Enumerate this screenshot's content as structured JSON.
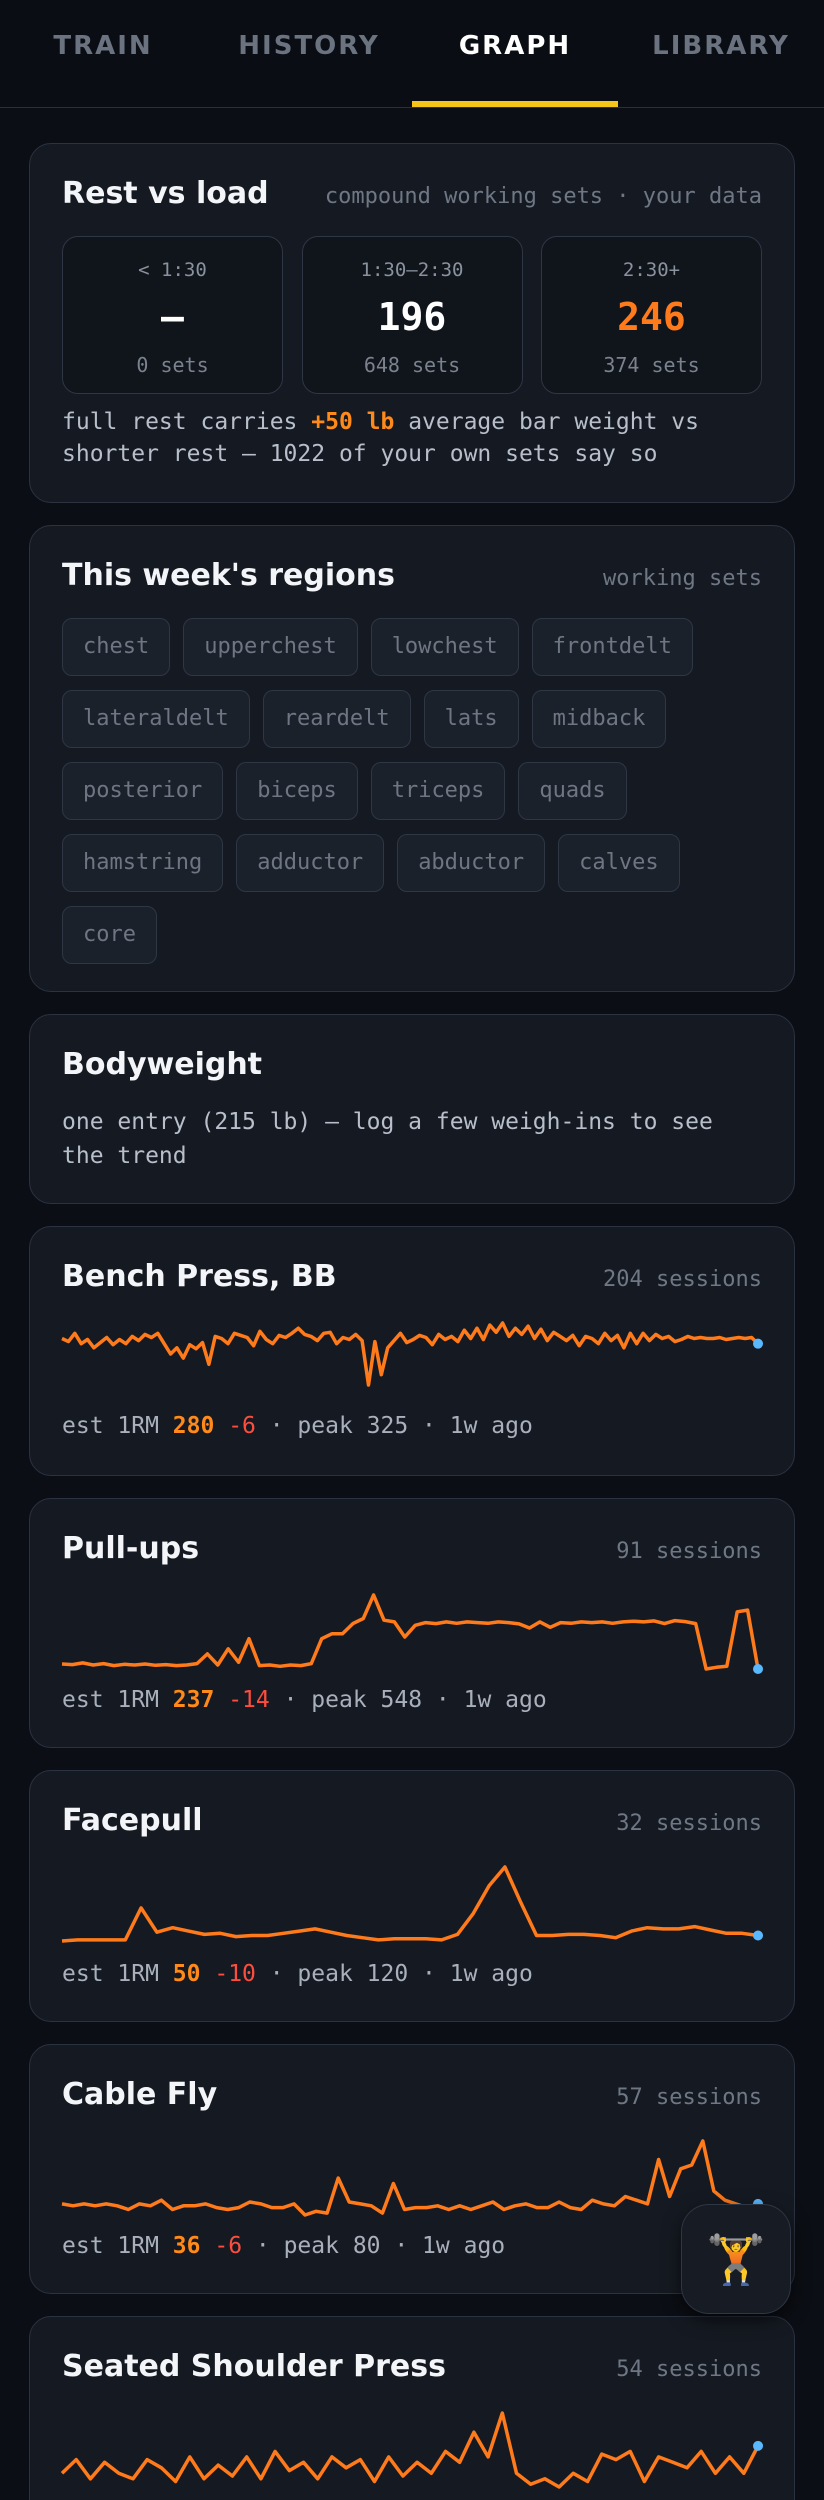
{
  "tabs": [
    {
      "label": "TRAIN"
    },
    {
      "label": "HISTORY"
    },
    {
      "label": "GRAPH"
    },
    {
      "label": "LIBRARY"
    }
  ],
  "rest_vs_load": {
    "title": "Rest vs load",
    "meta": "compound working sets · your data",
    "buckets": [
      {
        "label": "< 1:30",
        "value": "—",
        "count": "0 sets"
      },
      {
        "label": "1:30–2:30",
        "value": "196",
        "count": "648 sets"
      },
      {
        "label": "2:30+",
        "value": "246",
        "count": "374 sets"
      }
    ],
    "note_pre": "full rest carries ",
    "note_highlight": "+50 lb",
    "note_post": " average bar weight vs shorter rest — 1022 of your own sets say so"
  },
  "regions": {
    "title": "This week's regions",
    "meta": "working sets",
    "chips": [
      "chest",
      "upperchest",
      "lowchest",
      "frontdelt",
      "lateraldelt",
      "reardelt",
      "lats",
      "midback",
      "posterior",
      "biceps",
      "triceps",
      "quads",
      "hamstring",
      "adductor",
      "abductor",
      "calves",
      "core"
    ]
  },
  "bodyweight": {
    "title": "Bodyweight",
    "note": "one entry (215 lb) — log a few weigh-ins to see the trend"
  },
  "exercises": [
    {
      "name": "Bench Press, BB",
      "sessions": "204 sessions",
      "est_prefix": "est 1RM ",
      "est": "280",
      "delta": "-6",
      "suffix": " · peak 325 · 1w ago",
      "chart_data": {
        "type": "line",
        "values": [
          285,
          282,
          290,
          280,
          284,
          276,
          281,
          286,
          279,
          284,
          280,
          287,
          283,
          289,
          286,
          290,
          280,
          270,
          276,
          266,
          279,
          275,
          281,
          260,
          287,
          285,
          280,
          290,
          288,
          286,
          278,
          292,
          284,
          280,
          288,
          286,
          290,
          295,
          289,
          287,
          283,
          290,
          291,
          280,
          286,
          284,
          289,
          283,
          240,
          282,
          250,
          276,
          283,
          290,
          281,
          284,
          288,
          286,
          279,
          289,
          284,
          287,
          282,
          293,
          285,
          295,
          284,
          298,
          291,
          300,
          287,
          295,
          289,
          297,
          285,
          294,
          283,
          291,
          287,
          283,
          288,
          278,
          287,
          285,
          280,
          290,
          283,
          288,
          276,
          290,
          280,
          290,
          283,
          289,
          285,
          287,
          282,
          284,
          287,
          285,
          286,
          285,
          285,
          286,
          284,
          285,
          286,
          285,
          286,
          280
        ]
      }
    },
    {
      "name": "Pull-ups",
      "sessions": "91 sessions",
      "est_prefix": "est 1RM ",
      "est": "237",
      "delta": "-14",
      "suffix": " · peak 548 · 1w ago",
      "chart_data": {
        "type": "line",
        "values": [
          255,
          253,
          258,
          252,
          256,
          250,
          254,
          252,
          255,
          251,
          253,
          250,
          252,
          256,
          285,
          252,
          300,
          260,
          330,
          250,
          252,
          248,
          252,
          250,
          256,
          330,
          345,
          345,
          375,
          390,
          460,
          385,
          380,
          335,
          370,
          378,
          375,
          380,
          376,
          380,
          378,
          376,
          380,
          378,
          374,
          362,
          380,
          364,
          378,
          376,
          380,
          378,
          380,
          376,
          380,
          382,
          380,
          383,
          375,
          384,
          381,
          375,
          240,
          245,
          248,
          410,
          415,
          240
        ]
      }
    },
    {
      "name": "Facepull",
      "sessions": "32 sessions",
      "est_prefix": "est 1RM ",
      "est": "50",
      "delta": "-10",
      "suffix": " · peak 120 · 1w ago",
      "chart_data": {
        "type": "line",
        "values": [
          45,
          46,
          46,
          46,
          46,
          75,
          53,
          57,
          54,
          51,
          52,
          49,
          50,
          50,
          52,
          54,
          56,
          53,
          50,
          48,
          46,
          47,
          47,
          47,
          46,
          51,
          70,
          95,
          112,
          80,
          50,
          50,
          51,
          51,
          50,
          48,
          54,
          57,
          56,
          56,
          58,
          55,
          52,
          52,
          50
        ]
      }
    },
    {
      "name": "Cable Fly",
      "sessions": "57 sessions",
      "est_prefix": "est 1RM ",
      "est": "36",
      "delta": "-6",
      "suffix": " · peak 80 · 1w ago",
      "chart_data": {
        "type": "line",
        "values": [
          36,
          35,
          36,
          35,
          36,
          35,
          33,
          36,
          35,
          38,
          33,
          35,
          35,
          36,
          34,
          33,
          34,
          37,
          36,
          34,
          34,
          36,
          30,
          32,
          31,
          50,
          37,
          36,
          35,
          31,
          47,
          33,
          34,
          34,
          35,
          33,
          35,
          33,
          35,
          37,
          33,
          35,
          36,
          34,
          34,
          37,
          34,
          33,
          38,
          36,
          35,
          40,
          38,
          36,
          60,
          40,
          55,
          57,
          70,
          43,
          38,
          36,
          34,
          36
        ]
      }
    },
    {
      "name": "Seated Shoulder Press",
      "sessions": "54 sessions",
      "est_prefix": "",
      "est": "",
      "delta": "",
      "suffix": "",
      "chart_data": {
        "type": "line",
        "values": [
          60,
          65,
          58,
          64,
          60,
          58,
          65,
          62,
          57,
          66,
          58,
          63,
          59,
          66,
          58,
          68,
          61,
          64,
          58,
          66,
          62,
          65,
          57,
          66,
          59,
          64,
          60,
          68,
          64,
          75,
          66,
          82,
          60,
          56,
          58,
          55,
          60,
          57,
          67,
          65,
          68,
          57,
          66,
          64,
          62,
          68,
          60,
          66,
          60,
          70
        ]
      }
    }
  ],
  "colors": {
    "accent": "#f5c518",
    "line": "#ff7a1a",
    "endpoint": "#5ab8ff",
    "delta": "#ff4d3d"
  },
  "fab": {
    "icon": "weightlifter-icon",
    "glyph": "🏋️"
  }
}
